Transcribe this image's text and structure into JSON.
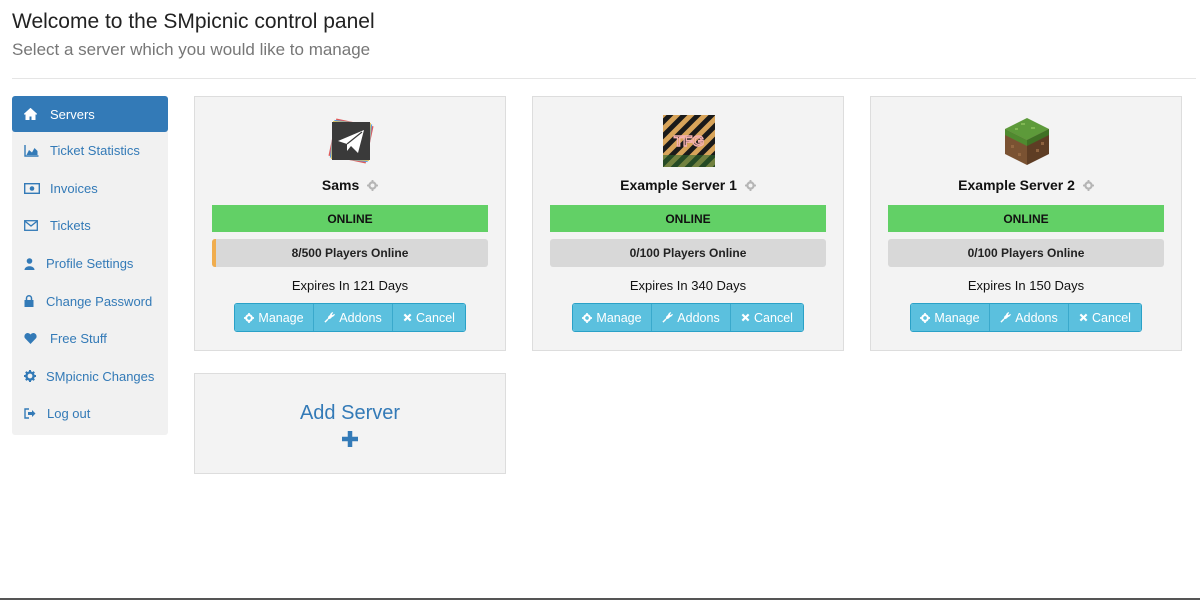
{
  "header": {
    "title": "Welcome to the SMpicnic control panel",
    "subtitle": "Select a server which you would like to manage"
  },
  "sidebar": {
    "items": [
      {
        "label": "Servers",
        "icon": "home-icon",
        "active": true
      },
      {
        "label": "Ticket Statistics",
        "icon": "area-chart-icon"
      },
      {
        "label": "Invoices",
        "icon": "money-icon"
      },
      {
        "label": "Tickets",
        "icon": "envelope-icon"
      },
      {
        "label": "Profile Settings",
        "icon": "user-icon"
      },
      {
        "label": "Change Password",
        "icon": "lock-icon"
      },
      {
        "label": "Free Stuff",
        "icon": "heart-icon"
      },
      {
        "label": "SMpicnic Changes",
        "icon": "gear-icon"
      },
      {
        "label": "Log out",
        "icon": "sign-out-icon"
      }
    ]
  },
  "servers": [
    {
      "name": "Sams",
      "logo": "paper-plane-logo",
      "status": "ONLINE",
      "players": "8/500 Players Online",
      "players_fraction": 0.016,
      "expires": "Expires In 121 Days"
    },
    {
      "name": "Example Server 1",
      "logo": "tfg-striped-logo",
      "logo_text": "TFG",
      "status": "ONLINE",
      "players": "0/100 Players Online",
      "players_fraction": 0,
      "expires": "Expires In 340 Days"
    },
    {
      "name": "Example Server 2",
      "logo": "grass-block-logo",
      "status": "ONLINE",
      "players": "0/100 Players Online",
      "players_fraction": 0,
      "expires": "Expires In 150 Days"
    }
  ],
  "buttons": {
    "manage": "Manage",
    "addons": "Addons",
    "cancel": "Cancel"
  },
  "add_server": {
    "label": "Add Server"
  },
  "colors": {
    "primary": "#337ab7",
    "online": "#62d066",
    "info_button": "#5bc0de",
    "players_fill": "#f0ad4e"
  }
}
